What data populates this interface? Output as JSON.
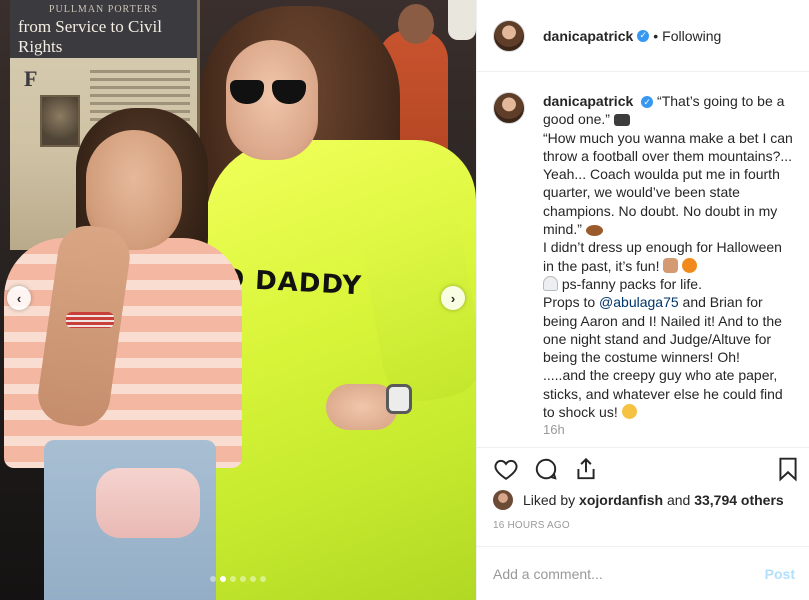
{
  "photo": {
    "poster_heading": "PULLMAN PORTERS",
    "poster_title": "from Service to Civil Rights",
    "poster_letter": "F",
    "jumpsuit_text": "O DADDY",
    "carousel": {
      "dots": 6,
      "active_index": 1
    },
    "nav_prev_symbol": "‹",
    "nav_next_symbol": "›"
  },
  "header": {
    "username": "danicapatrick",
    "verified_symbol": "✓",
    "separator": "•",
    "follow_status": "Following"
  },
  "caption": {
    "username": "danicapatrick",
    "line1": "“That’s going to be a good one.”",
    "quote": "“How much you wanna make a bet I can throw a football over them mountains?... Yeah... Coach woulda put me in fourth quarter, we would’ve been state champions. No doubt. No doubt in my mind.”",
    "halloween": "I didn’t dress up enough for Halloween in the past, it’s fun!",
    "fanny": "ps-fanny packs for life.",
    "props_prefix": "Props to",
    "mention": "@abulaga75",
    "props_suffix": "and Brian for being Aaron and I! Nailed it! And to the one night stand and Judge/Altuve for being the costume winners! Oh!",
    "creepy": ".....and the creepy guy who ate paper, sticks, and whatever else he could find to shock us!",
    "comments_stub": "16h"
  },
  "likes": {
    "prefix": "Liked by",
    "user": "xojordanfish",
    "middle": "and",
    "count": "33,794 others"
  },
  "timestamp": "16 HOURS AGO",
  "comment_box": {
    "placeholder": "Add a comment...",
    "post_label": "Post"
  },
  "colors": {
    "link": "#003569",
    "verified": "#3897f0",
    "post_disabled": "#b2dffc",
    "muted": "#999999",
    "text": "#262626"
  }
}
